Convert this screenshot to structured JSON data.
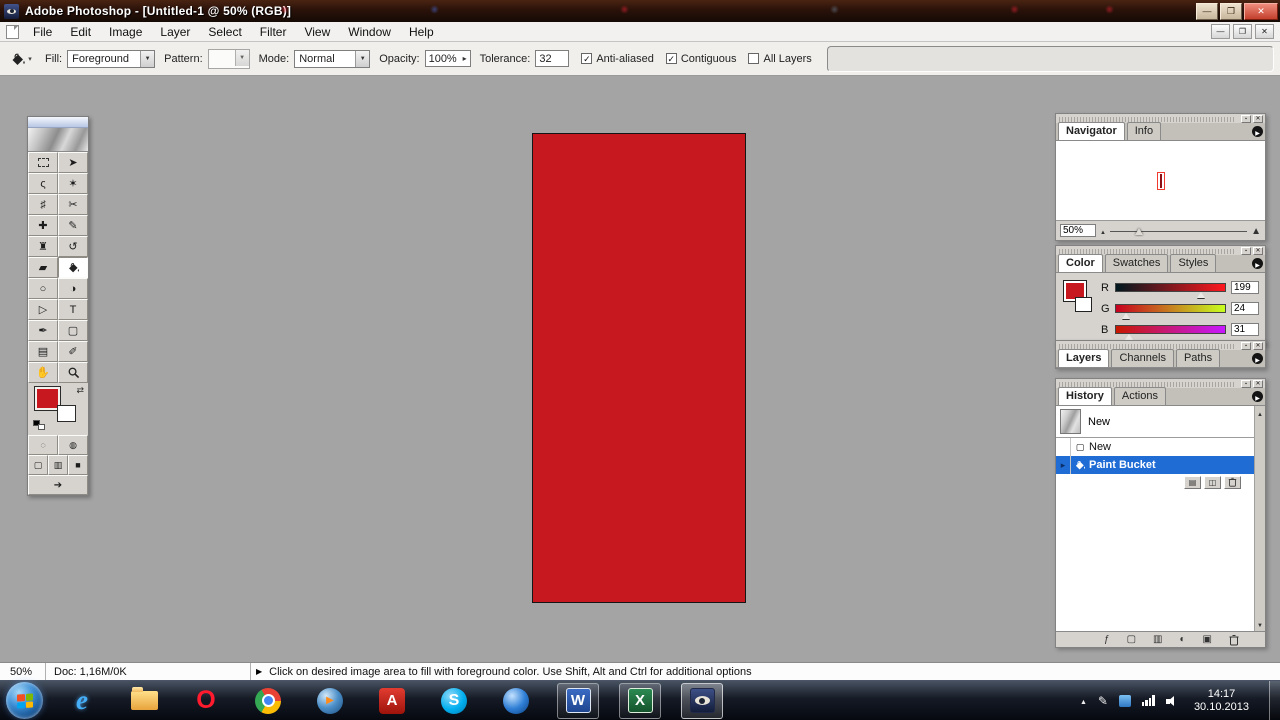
{
  "colors": {
    "canvas_red": "#c7181f",
    "selection_blue": "#1f6cd5",
    "workspace_gray": "#a4a4a4"
  },
  "titlebar": {
    "title": "Adobe Photoshop - [Untitled-1 @ 50% (RGB)]"
  },
  "window_buttons": {
    "minimize": "—",
    "maximize": "❐",
    "close": "✕"
  },
  "menu": {
    "items": [
      "File",
      "Edit",
      "Image",
      "Layer",
      "Select",
      "Filter",
      "View",
      "Window",
      "Help"
    ]
  },
  "doc_controls": {
    "minimize": "—",
    "restore": "❐",
    "close": "✕"
  },
  "options_bar": {
    "tool_icon": "paint-bucket-icon",
    "fill_label": "Fill:",
    "fill_value": "Foreground",
    "pattern_label": "Pattern:",
    "mode_label": "Mode:",
    "mode_value": "Normal",
    "opacity_label": "Opacity:",
    "opacity_value": "100%",
    "tolerance_label": "Tolerance:",
    "tolerance_value": "32",
    "checkboxes": [
      {
        "label": "Anti-aliased",
        "checked": true,
        "mark": "✓"
      },
      {
        "label": "Contiguous",
        "checked": true,
        "mark": "✓"
      },
      {
        "label": "All Layers",
        "checked": false,
        "mark": ""
      }
    ]
  },
  "toolbox": {
    "tools": [
      {
        "name": "rectangular-marquee",
        "glyph": ""
      },
      {
        "name": "move",
        "glyph": "➤"
      },
      {
        "name": "lasso",
        "glyph": "ς"
      },
      {
        "name": "magic-wand",
        "glyph": "✶"
      },
      {
        "name": "crop",
        "glyph": "♯"
      },
      {
        "name": "slice",
        "glyph": "✂"
      },
      {
        "name": "healing-brush",
        "glyph": "✚"
      },
      {
        "name": "brush",
        "glyph": "✎"
      },
      {
        "name": "clone-stamp",
        "glyph": "♜"
      },
      {
        "name": "history-brush",
        "glyph": "↺"
      },
      {
        "name": "eraser",
        "glyph": "▰"
      },
      {
        "name": "paint-bucket",
        "glyph": "",
        "selected": true
      },
      {
        "name": "blur",
        "glyph": "○"
      },
      {
        "name": "dodge",
        "glyph": "◑"
      },
      {
        "name": "path-selection",
        "glyph": "▷"
      },
      {
        "name": "type",
        "glyph": "T"
      },
      {
        "name": "pen",
        "glyph": "✒"
      },
      {
        "name": "shape",
        "glyph": "▢"
      },
      {
        "name": "notes",
        "glyph": "▤"
      },
      {
        "name": "eyedropper",
        "glyph": "✐"
      },
      {
        "name": "hand",
        "glyph": "✋"
      },
      {
        "name": "zoom",
        "glyph": ""
      }
    ],
    "quick_mask": [
      "◌",
      "◍"
    ],
    "screen_modes": [
      "▢",
      "▥",
      "■"
    ],
    "jump_to": "➔"
  },
  "navigator": {
    "tabs": [
      "Navigator",
      "Info"
    ],
    "active_tab": "Navigator",
    "zoom": "50%"
  },
  "color_panel": {
    "tabs": [
      "Color",
      "Swatches",
      "Styles"
    ],
    "active_tab": "Color",
    "channels": [
      {
        "label": "R",
        "value": "199"
      },
      {
        "label": "G",
        "value": "24"
      },
      {
        "label": "B",
        "value": "31"
      }
    ]
  },
  "layers_panel": {
    "tabs": [
      "Layers",
      "Channels",
      "Paths"
    ],
    "active_tab": "Layers"
  },
  "history_panel": {
    "tabs": [
      "History",
      "Actions"
    ],
    "active_tab": "History",
    "snapshot_label": "New",
    "states": [
      {
        "label": "New",
        "selected": false
      },
      {
        "label": "Paint Bucket",
        "selected": true
      }
    ]
  },
  "status_bar": {
    "zoom": "50%",
    "doc_info": "Doc: 1,16M/0K",
    "tip": "Click on desired image area to fill with foreground color.  Use Shift, Alt and Ctrl for additional options"
  },
  "taskbar": {
    "apps": [
      {
        "name": "internet-explorer",
        "letter": "e"
      },
      {
        "name": "windows-explorer",
        "letter": ""
      },
      {
        "name": "opera",
        "letter": "O"
      },
      {
        "name": "chrome",
        "letter": ""
      },
      {
        "name": "media-player",
        "letter": ""
      },
      {
        "name": "adobe-reader",
        "letter": "A"
      },
      {
        "name": "skype",
        "letter": "S"
      },
      {
        "name": "blue-app",
        "letter": ""
      },
      {
        "name": "word",
        "letter": "W",
        "open": true
      },
      {
        "name": "excel",
        "letter": "X",
        "open": true
      },
      {
        "name": "photoshop",
        "letter": "",
        "active": true
      }
    ],
    "clock_time": "14:17",
    "clock_date": "30.10.2013"
  }
}
